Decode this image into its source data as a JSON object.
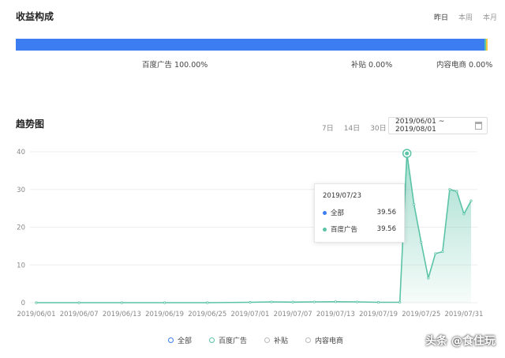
{
  "composition": {
    "title": "收益构成",
    "period_tabs": [
      {
        "label": "昨日",
        "active": true
      },
      {
        "label": "本周",
        "active": false
      },
      {
        "label": "本月",
        "active": false
      }
    ],
    "segments": [
      {
        "name": "百度广告",
        "percent": "100.00%",
        "share": 0.993,
        "color": "#3d7df2"
      },
      {
        "name": "补贴",
        "percent": "0.00%",
        "share": 0.004,
        "color": "#5bc3a6"
      },
      {
        "name": "内容电商",
        "percent": "0.00%",
        "share": 0.003,
        "color": "#f5c842"
      }
    ]
  },
  "trend": {
    "title": "趋势图",
    "range_tabs": [
      "7日",
      "14日",
      "30日"
    ],
    "date_range": "2019/06/01 ~ 2019/08/01"
  },
  "chart_data": {
    "type": "area",
    "x_ticks": [
      "2019/06/01",
      "2019/06/07",
      "2019/06/13",
      "2019/06/19",
      "2019/06/25",
      "2019/07/01",
      "2019/07/07",
      "2019/07/13",
      "2019/07/19",
      "2019/07/25",
      "2019/07/31"
    ],
    "ylim": [
      0,
      40
    ],
    "y_ticks": [
      0,
      10,
      20,
      30,
      40
    ],
    "series": [
      {
        "name": "百度广告",
        "color": "#5bc3a6",
        "points": [
          [
            "2019/06/01",
            0
          ],
          [
            "2019/06/07",
            0
          ],
          [
            "2019/06/13",
            0
          ],
          [
            "2019/06/19",
            0
          ],
          [
            "2019/06/25",
            0
          ],
          [
            "2019/07/01",
            0.1
          ],
          [
            "2019/07/04",
            0.2
          ],
          [
            "2019/07/07",
            0.15
          ],
          [
            "2019/07/10",
            0.2
          ],
          [
            "2019/07/13",
            0.25
          ],
          [
            "2019/07/16",
            0.2
          ],
          [
            "2019/07/19",
            0.1
          ],
          [
            "2019/07/22",
            0.1
          ],
          [
            "2019/07/23",
            39.56
          ],
          [
            "2019/07/24",
            26
          ],
          [
            "2019/07/25",
            16
          ],
          [
            "2019/07/26",
            6.5
          ],
          [
            "2019/07/27",
            13
          ],
          [
            "2019/07/28",
            13.5
          ],
          [
            "2019/07/29",
            30
          ],
          [
            "2019/07/30",
            29.5
          ],
          [
            "2019/07/31",
            23.5
          ],
          [
            "2019/08/01",
            27
          ]
        ]
      }
    ],
    "tooltip": {
      "date": "2019/07/23",
      "rows": [
        {
          "name": "全部",
          "value": "39.56",
          "color": "#3d7df2"
        },
        {
          "name": "百度广告",
          "value": "39.56",
          "color": "#5bc3a6"
        }
      ]
    },
    "legend": [
      {
        "name": "全部",
        "color": "#3d7df2"
      },
      {
        "name": "百度广告",
        "color": "#5bc3a6"
      },
      {
        "name": "补贴",
        "color": "#bbbbbb"
      },
      {
        "name": "内容电商",
        "color": "#bbbbbb"
      }
    ]
  },
  "watermark": "头条 @食住玩"
}
